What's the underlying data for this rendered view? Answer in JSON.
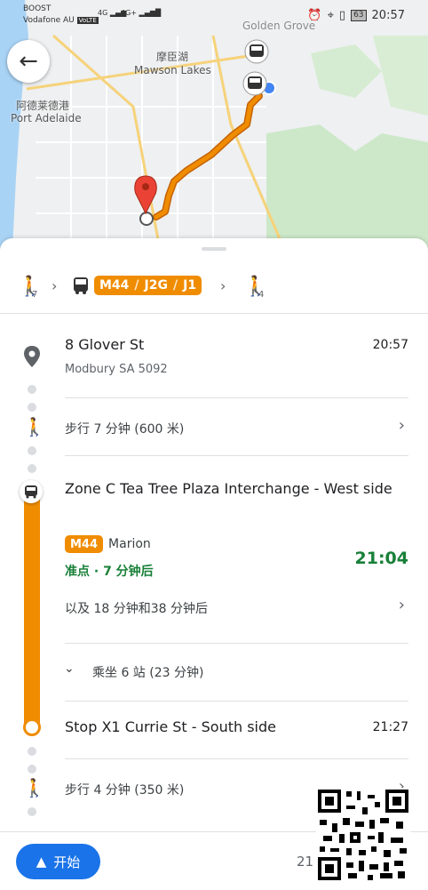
{
  "status_bar": {
    "carrier1": "BOOST",
    "carrier2": "Vodafone AU",
    "volte": "VoLTE",
    "net1": "4G",
    "net2": "4G+",
    "battery": "63",
    "time": "20:57"
  },
  "map": {
    "labels": {
      "golden_grove": "Golden Grove",
      "mawson_cn": "摩臣湖",
      "mawson_en": "Mawson Lakes",
      "adelaide_cn": "阿德莱德港",
      "adelaide_en": "Port Adelaide"
    },
    "colors": {
      "route": "#e8710a",
      "route_light": "#f5a94c",
      "pin": "#ea4335",
      "location": "#4285f4"
    }
  },
  "summary": {
    "walk1_minutes": "7",
    "routes": [
      "M44",
      "J2G",
      "J1"
    ],
    "walk2_minutes": "4",
    "accent": "#f08c00"
  },
  "steps": {
    "origin": {
      "title": "8 Glover St",
      "subtitle": "Modbury SA 5092",
      "time": "20:57"
    },
    "walk1": {
      "text": "步行 7 分钟 (600 米)"
    },
    "board_stop": {
      "title": "Zone C Tea Tree Plaza Interchange - West side"
    },
    "bus": {
      "route": "M44",
      "destination": "Marion",
      "status": "准点 · 7 分钟后",
      "time": "21:04",
      "status_color": "#188038"
    },
    "later": {
      "text": "以及 18 分钟和38 分钟后"
    },
    "ride": {
      "text": "乘坐 6 站 (23 分钟)"
    },
    "alight_stop": {
      "title": "Stop X1 Currie St - South side",
      "time": "21:27"
    },
    "walk2": {
      "text": "步行 4 分钟 (350 米)"
    }
  },
  "bottom_bar": {
    "start_label": "开始",
    "eta_partial": "21"
  }
}
